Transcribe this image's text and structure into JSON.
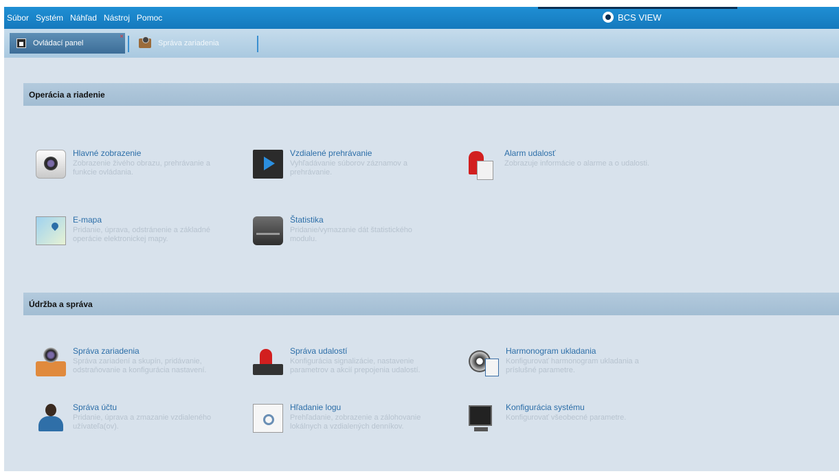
{
  "menu": [
    "Súbor",
    "Systém",
    "Náhľad",
    "Nástroj",
    "Pomoc"
  ],
  "brand": "BCS VIEW",
  "tabs": [
    {
      "label": "Ovládací panel",
      "active": true
    },
    {
      "label": "Správa zariadenia",
      "active": false
    }
  ],
  "sections": [
    {
      "title": "Operácia a riadenie",
      "items": [
        {
          "icon": "camera-icon",
          "title": "Hlavné zobrazenie",
          "desc": "Zobrazenie živého obrazu, prehrávanie a funkcie ovládania."
        },
        {
          "icon": "play-icon",
          "title": "Vzdialené prehrávanie",
          "desc": "Vyhľadávanie súborov záznamov a prehrávanie."
        },
        {
          "icon": "alarm-icon",
          "title": "Alarm udalosť",
          "desc": "Zobrazuje informácie o alarme a o udalosti."
        },
        {
          "icon": "map-icon",
          "title": "E-mapa",
          "desc": "Pridanie, úprava, odstránenie a základné operácie elektronickej mapy."
        },
        {
          "icon": "disk-icon",
          "title": "Štatistika",
          "desc": "Pridanie/vymazanie dát štatistického modulu."
        }
      ]
    },
    {
      "title": "Údržba a správa",
      "items": [
        {
          "icon": "device-icon",
          "title": "Správa zariadenia",
          "desc": "Správa zariadení a skupín, pridávanie, odstraňovanie a konfigurácia nastavení."
        },
        {
          "icon": "event-icon",
          "title": "Správa udalostí",
          "desc": "Konfigurácia signalizácie, nastavenie parametrov a akcií prepojenia udalostí."
        },
        {
          "icon": "schedule-icon",
          "title": "Harmonogram ukladania",
          "desc": "Konfigurovať harmonogram ukladania a príslušné parametre."
        },
        {
          "icon": "user-icon",
          "title": "Správa účtu",
          "desc": "Pridanie, úprava a zmazanie vzdialeného užívateľa(ov)."
        },
        {
          "icon": "log-icon",
          "title": "Hľadanie logu",
          "desc": "Prehľadanie, zobrazenie a zálohovanie lokálnych a vzdialených denníkov."
        },
        {
          "icon": "config-icon",
          "title": "Konfigurácia systému",
          "desc": "Konfigurovať všeobecné parametre."
        }
      ]
    }
  ]
}
